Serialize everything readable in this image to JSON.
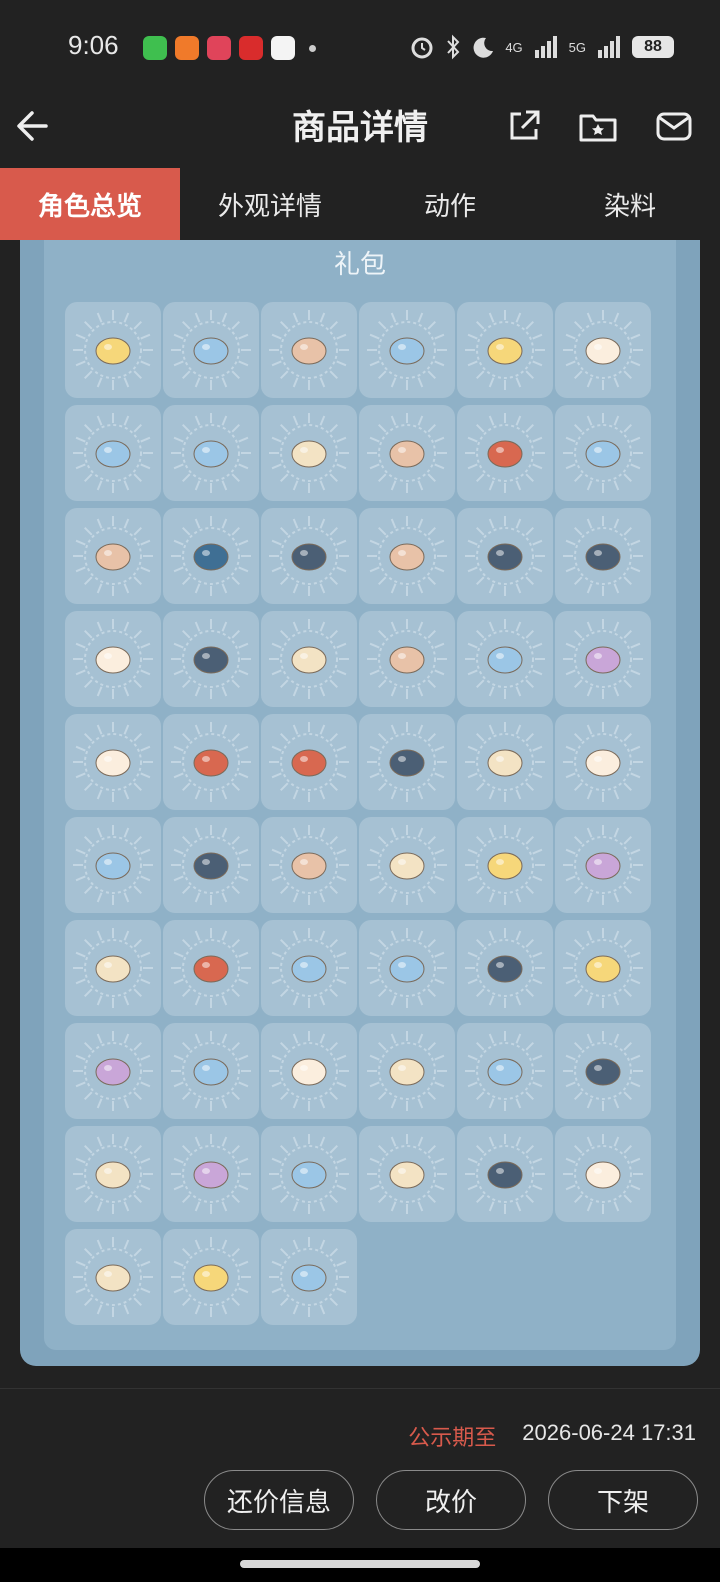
{
  "status_bar": {
    "time": "9:06",
    "battery": "88",
    "signal_1": "4G",
    "signal_2": "5G"
  },
  "header": {
    "title": "商品详情"
  },
  "tabs": [
    {
      "label": "角色总览",
      "active": true
    },
    {
      "label": "外观详情",
      "active": false
    },
    {
      "label": "动作",
      "active": false
    },
    {
      "label": "染料",
      "active": false
    }
  ],
  "section": {
    "title": "礼包"
  },
  "items": [
    "mask-icon",
    "tv-headband-icon",
    "heart-wings-icon",
    "hair-icon",
    "bow-hair-icon",
    "purple-cape-icon",
    "hood-icon",
    "ear-headband-icon",
    "purple-tutu-icon",
    "bow-necklace-icon",
    "scarf-icon",
    "top-hat-icon",
    "sparkle-badge-icon",
    "teal-wings-icon",
    "bunny-flower-icon",
    "blob-pet-icon",
    "ponytail-icon",
    "teal-cape-icon",
    "folding-fan-icon",
    "flower-petals-icon",
    "cat-ears-icon",
    "long-hair-icon",
    "red-ball-icon",
    "horns-icon",
    "blue-wings-icon",
    "yellow-tie-cape-icon",
    "fox-icon",
    "chain-necklace-icon",
    "navy-cape-icon",
    "cat-hat-icon",
    "robe-outfit-icon",
    "earring-icon",
    "guitar-icon",
    "pearl-necklace-icon",
    "duck-pet-icon",
    "cat-face-icon",
    "strand-hair-icon",
    "cat-ears-headband-icon",
    "lace-tutu-icon",
    "pumpkin-icon",
    "bat-wings-icon",
    "witch-hat-icon",
    "pink-outfit-icon",
    "bead-necklace-icon",
    "doll-face-icon",
    "red-cape-icon",
    "bun-hair-icon",
    "fruit-icon",
    "curly-hair-icon",
    "twin-buns-icon",
    "puppy-icon",
    "bowtie-necklace-icon",
    "cloud-icon",
    "shoe-icon",
    "gold-bow-icon",
    "white-dress-icon",
    "pink-shoes-icon"
  ],
  "colors": {
    "accent": "#d85a4c",
    "panel": "#7fa3bb",
    "cell": "#a6c1d3"
  },
  "footer": {
    "publish_label": "公示期至",
    "publish_date": "2026-06-24 17:31",
    "buttons": {
      "counter_offer": "还价信息",
      "reprice": "改价",
      "delist": "下架"
    }
  }
}
